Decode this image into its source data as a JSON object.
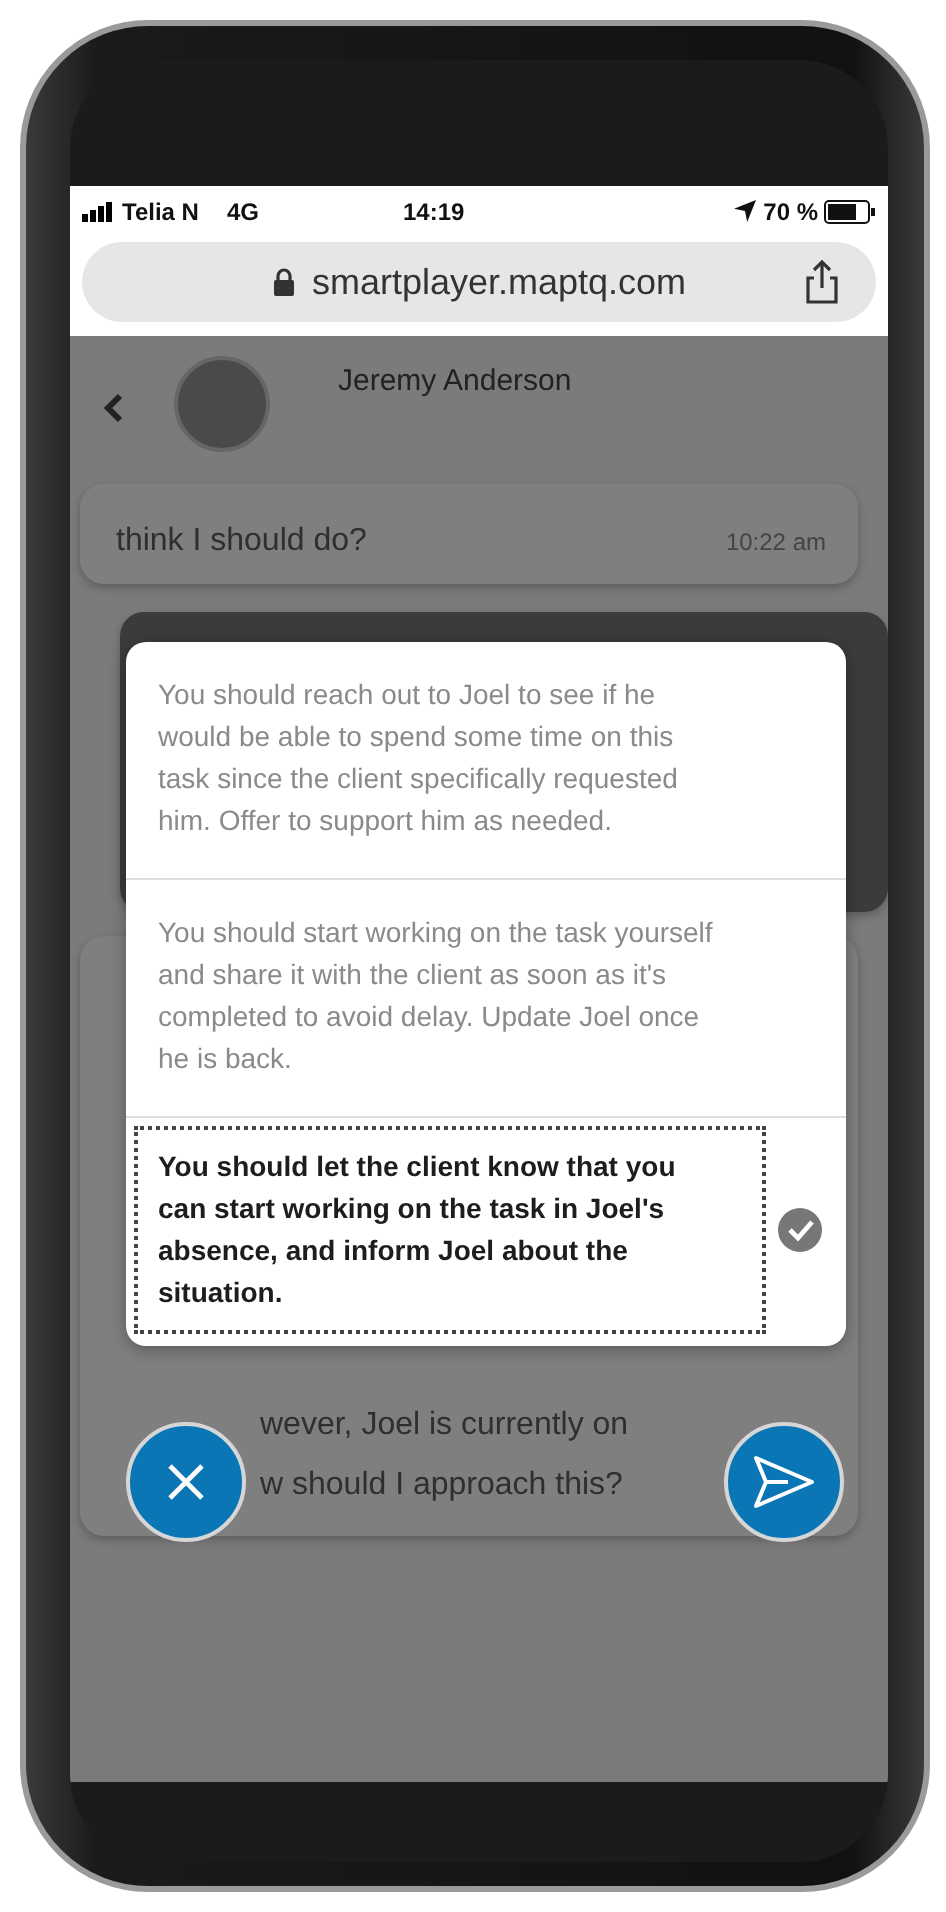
{
  "status_bar": {
    "carrier": "Telia N",
    "network": "4G",
    "time": "14:19",
    "battery": "70 %"
  },
  "browser": {
    "url": "smartplayer.maptq.com"
  },
  "chat": {
    "contact": "Jeremy Anderson",
    "messages": [
      {
        "kind": "incoming",
        "lines": [
          "think I should do?"
        ],
        "time": "10:22 am"
      },
      {
        "kind": "dark"
      },
      {
        "kind": "covered",
        "lines": [
          "wever, Joel is currently on",
          "w should I approach this?"
        ]
      }
    ]
  },
  "options": [
    {
      "text": "You should reach out to Joel to see if he would be able to spend some time on this task since the client specifically requested him. Offer to support him as needed.",
      "selected": false
    },
    {
      "text": "You should start working on the task yourself and share it with the client as soon as it's completed to avoid delay. Update Joel once he is back.",
      "selected": false
    },
    {
      "text": "You should let the client know that you can start working on the task in Joel's absence, and inform Joel about the situation.",
      "selected": true
    }
  ]
}
